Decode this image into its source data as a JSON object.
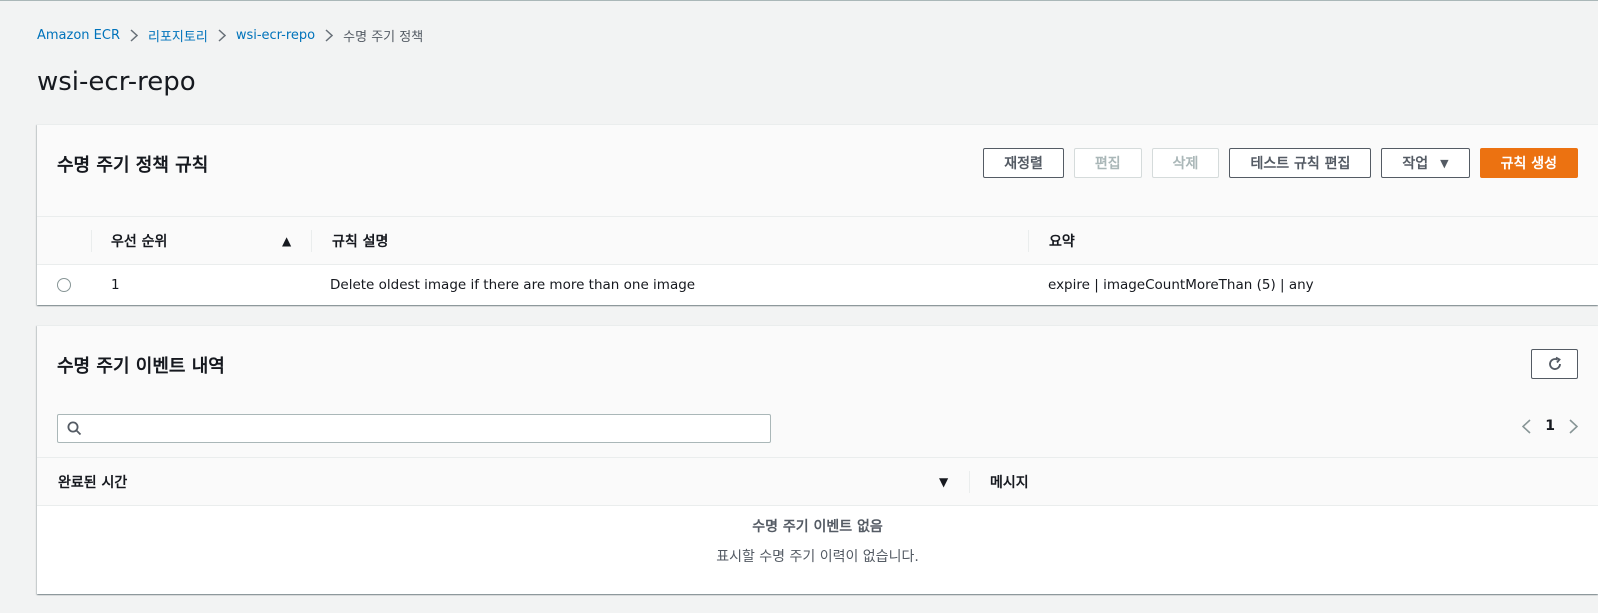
{
  "breadcrumb": {
    "items": [
      "Amazon ECR",
      "리포지토리",
      "wsi-ecr-repo"
    ],
    "current": "수명 주기 정책"
  },
  "page": {
    "title": "wsi-ecr-repo"
  },
  "rules_panel": {
    "title": "수명 주기 정책 규칙",
    "buttons": {
      "reorder": "재정렬",
      "edit": "편집",
      "delete": "삭제",
      "edit_test_rules": "테스트 규칙 편집",
      "actions": "작업",
      "create_rule": "규칙 생성"
    },
    "columns": [
      "우선 순위",
      "규칙 설명",
      "요약"
    ],
    "rows": [
      {
        "priority": "1",
        "description": "Delete oldest image if there are more than one image",
        "summary": "expire | imageCountMoreThan (5) | any"
      }
    ]
  },
  "events_panel": {
    "title": "수명 주기 이벤트 내역",
    "search": {
      "value": "",
      "placeholder": ""
    },
    "pagination": {
      "current_page": "1"
    },
    "columns": [
      "완료된 시간",
      "메시지"
    ],
    "empty_title": "수명 주기 이벤트 없음",
    "empty_message": "표시할 수명 주기 이력이 없습니다."
  },
  "colors": {
    "link": "#0073bb",
    "primary": "#ec7211",
    "background": "#f2f3f3"
  }
}
